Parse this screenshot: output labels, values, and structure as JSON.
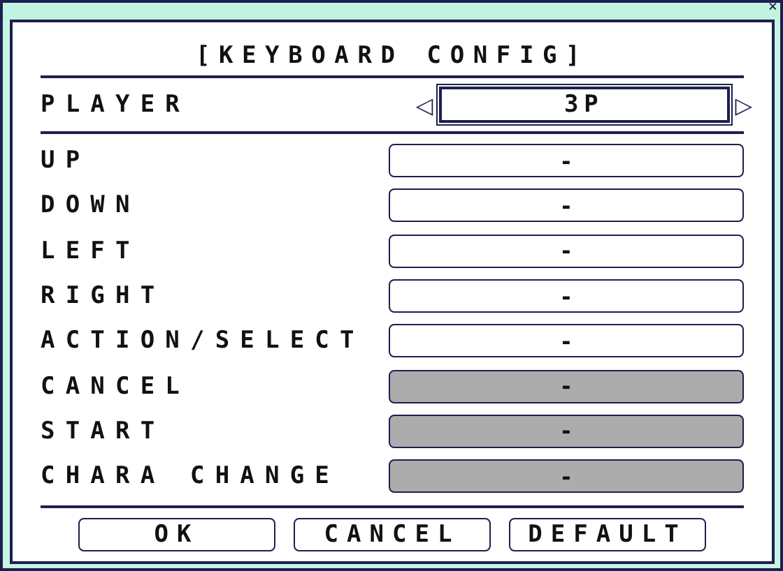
{
  "window": {
    "close": "×"
  },
  "title": "[KEYBOARD CONFIG]",
  "player": {
    "label": "PLAYER",
    "prev": "◁",
    "value": "3P",
    "next": "▷"
  },
  "bindings": [
    {
      "label": "UP",
      "value": "-",
      "disabled": false
    },
    {
      "label": "DOWN",
      "value": "-",
      "disabled": false
    },
    {
      "label": "LEFT",
      "value": "-",
      "disabled": false
    },
    {
      "label": "RIGHT",
      "value": "-",
      "disabled": false
    },
    {
      "label": "ACTION/SELECT",
      "value": "-",
      "disabled": false
    },
    {
      "label": "CANCEL",
      "value": "-",
      "disabled": true
    },
    {
      "label": "START",
      "value": "-",
      "disabled": true
    },
    {
      "label": "CHARA CHANGE",
      "value": "-",
      "disabled": true
    }
  ],
  "buttons": [
    "OK",
    "CANCEL",
    "DEFAULT"
  ]
}
